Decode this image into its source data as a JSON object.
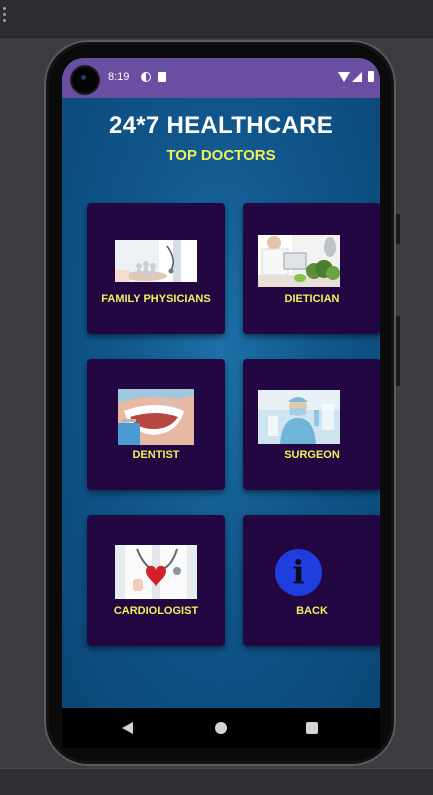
{
  "status_bar": {
    "time": "8:19"
  },
  "app": {
    "title": "24*7 HEALTHCARE",
    "subtitle": "TOP DOCTORS"
  },
  "cards": [
    {
      "label": "FAMILY PHYSICIANS",
      "image": "family-physicians-photo"
    },
    {
      "label": "DIETICIAN",
      "image": "dietician-photo"
    },
    {
      "label": "DENTIST",
      "image": "dentist-photo"
    },
    {
      "label": "SURGEON",
      "image": "surgeon-photo"
    },
    {
      "label": "CARDIOLOGIST",
      "image": "cardiologist-photo"
    },
    {
      "label": "BACK",
      "icon": "info-icon"
    }
  ],
  "colors": {
    "status_bar": "#6a4ea2",
    "card_bg": "#230743",
    "label_yellow": "#f3ef5b",
    "screen_blue": "#10578c",
    "info_blue": "#1f3ee0"
  }
}
